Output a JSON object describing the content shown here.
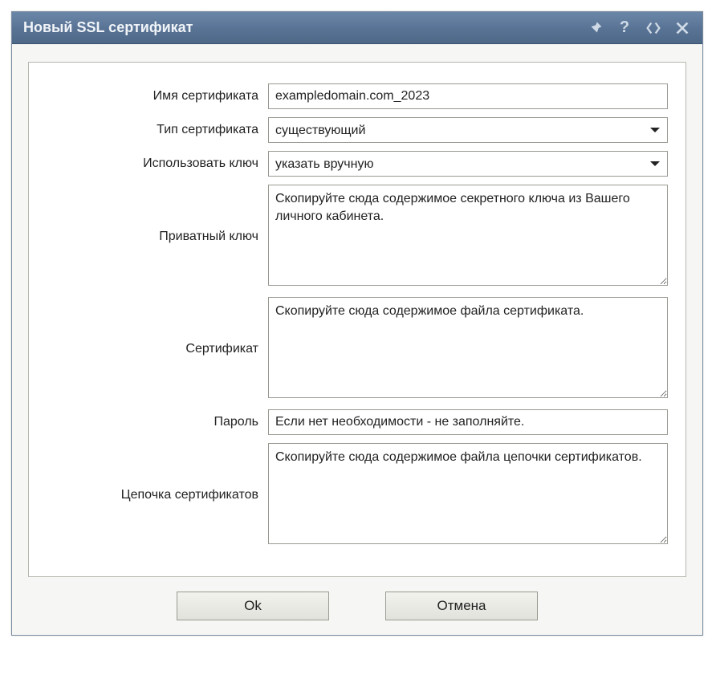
{
  "titlebar": {
    "title": "Новый SSL сертификат"
  },
  "form": {
    "cert_name": {
      "label": "Имя сертификата",
      "value": "exampledomain.com_2023"
    },
    "cert_type": {
      "label": "Тип сертификата",
      "selected": "существующий"
    },
    "use_key": {
      "label": "Использовать ключ",
      "selected": "указать вручную"
    },
    "private_key": {
      "label": "Приватный ключ",
      "placeholder": "Скопируйте сюда содержимое секретного ключа из Вашего личного кабинета."
    },
    "certificate": {
      "label": "Сертификат",
      "placeholder": "Скопируйте сюда содержимое файла сертификата."
    },
    "password": {
      "label": "Пароль",
      "placeholder": "Если нет необходимости - не заполняйте."
    },
    "cert_chain": {
      "label": "Цепочка сертификатов",
      "placeholder": "Скопируйте сюда содержимое файла цепочки сертификатов."
    }
  },
  "buttons": {
    "ok": "Ok",
    "cancel": "Отмена"
  }
}
